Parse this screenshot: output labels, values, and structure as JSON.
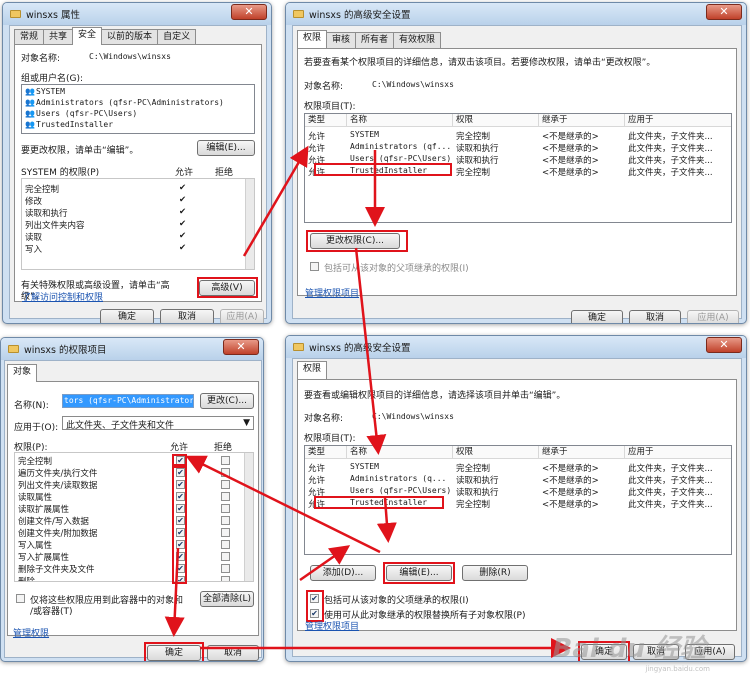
{
  "w1": {
    "title": "winsxs 属性",
    "tabs": [
      "常规",
      "共享",
      "安全",
      "以前的版本",
      "自定义"
    ],
    "obj_label": "对象名称:",
    "obj_value": "C:\\Windows\\winsxs",
    "group_label": "组或用户名(G):",
    "users": [
      "SYSTEM",
      "Administrators (qfsr-PC\\Administrators)",
      "Users (qfsr-PC\\Users)",
      "TrustedInstaller"
    ],
    "change_hint": "要更改权限，请单击“编辑”。",
    "edit_btn": "编辑(E)...",
    "perm_label": "SYSTEM 的权限(P)",
    "allow": "允许",
    "deny": "拒绝",
    "perms": [
      "完全控制",
      "修改",
      "读取和执行",
      "列出文件夹内容",
      "读取",
      "写入"
    ],
    "adv_hint1": "有关特殊权限或高级设置，请单击“高",
    "adv_hint2": "级”。",
    "adv_btn": "高级(V)",
    "link": "了解访问控制和权限",
    "ok": "确定",
    "cancel": "取消",
    "apply": "应用(A)"
  },
  "w2": {
    "title": "winsxs 的高级安全设置",
    "tabs": [
      "权限",
      "审核",
      "所有者",
      "有效权限"
    ],
    "desc": "若要查看某个权限项目的详细信息，请双击该项目。若要修改权限，请单击“更改权限”。",
    "obj_label": "对象名称:",
    "obj_value": "C:\\Windows\\winsxs",
    "entries_label": "权限项目(T):",
    "cols": [
      "类型",
      "名称",
      "权限",
      "继承于",
      "应用于"
    ],
    "rows": [
      [
        "允许",
        "SYSTEM",
        "完全控制",
        "<不是继承的>",
        "此文件夹，子文件夹..."
      ],
      [
        "允许",
        "Administrators (qf...",
        "读取和执行",
        "<不是继承的>",
        "此文件夹，子文件夹..."
      ],
      [
        "允许",
        "Users (qfsr-PC\\Users)",
        "读取和执行",
        "<不是继承的>",
        "此文件夹，子文件夹..."
      ],
      [
        "允许",
        "TrustedInstaller",
        "完全控制",
        "<不是继承的>",
        "此文件夹，子文件夹..."
      ]
    ],
    "change_btn": "更改权限(C)...",
    "inherit": "包括可从该对象的父项继承的权限(I)",
    "link": "管理权限项目",
    "ok": "确定",
    "cancel": "取消",
    "apply": "应用(A)"
  },
  "w3": {
    "title": "winsxs 的权限项目",
    "tab": "对象",
    "name_label": "名称(N):",
    "name_value": "tors (qfsr-PC\\Administrators)",
    "change_btn": "更改(C)...",
    "apply_label": "应用于(O):",
    "apply_value": "此文件夹、子文件夹和文件",
    "perm_label": "权限(P):",
    "allow": "允许",
    "deny": "拒绝",
    "perms": [
      "完全控制",
      "遍历文件夹/执行文件",
      "列出文件夹/读取数据",
      "读取属性",
      "读取扩展属性",
      "创建文件/写入数据",
      "创建文件夹/附加数据",
      "写入属性",
      "写入扩展属性",
      "删除子文件夹及文件",
      "删除"
    ],
    "only_cb1": "仅将这些权限应用到此容器中的对象和",
    "only_cb2": "/或容器(T)",
    "clear_btn": "全部清除(L)",
    "link": "管理权限",
    "ok": "确定",
    "cancel": "取消"
  },
  "w4": {
    "title": "winsxs 的高级安全设置",
    "tab": "权限",
    "desc": "要查看或编辑权限项目的详细信息，请选择该项目并单击“编辑”。",
    "obj_label": "对象名称:",
    "obj_value": "C:\\Windows\\winsxs",
    "entries_label": "权限项目(T):",
    "cols": [
      "类型",
      "名称",
      "权限",
      "继承于",
      "应用于"
    ],
    "rows": [
      [
        "允许",
        "SYSTEM",
        "完全控制",
        "<不是继承的>",
        "此文件夹，子文件夹..."
      ],
      [
        "允许",
        "Administrators (q...",
        "读取和执行",
        "<不是继承的>",
        "此文件夹，子文件夹..."
      ],
      [
        "允许",
        "Users (qfsr-PC\\Users)",
        "读取和执行",
        "<不是继承的>",
        "此文件夹，子文件夹..."
      ],
      [
        "允许",
        "TrustedInstaller",
        "完全控制",
        "<不是继承的>",
        "此文件夹，子文件夹..."
      ]
    ],
    "add_btn": "添加(D)...",
    "edit_btn": "编辑(E)...",
    "del_btn": "删除(R)",
    "cb1": "包括可从该对象的父项继承的权限(I)",
    "cb2": "使用可从此对象继承的权限替换所有子对象权限(P)",
    "link": "管理权限项目",
    "ok": "确定",
    "cancel": "取消",
    "apply": "应用(A)"
  },
  "watermark": "Bai du 经验",
  "watermark_sub": "jingyan.baidu.com",
  "annot_color": "#e0131b"
}
